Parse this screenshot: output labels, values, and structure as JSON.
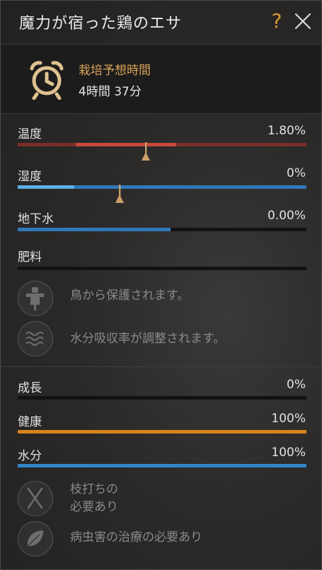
{
  "header": {
    "title": "魔力が宿った鶏のエサ",
    "help_label": "?"
  },
  "timer": {
    "label": "栽培予想時間",
    "value": "4時間 37分"
  },
  "environment": [
    {
      "label": "温度",
      "value": "1.80%",
      "color": "#c9493b"
    },
    {
      "label": "湿度",
      "value": "0%",
      "color": "#3a8cc8"
    },
    {
      "label": "地下水",
      "value": "0.00%",
      "fill_fraction": 0.53,
      "color": "#2f78b8"
    },
    {
      "label": "肥料",
      "value": "",
      "fill_fraction": 0
    }
  ],
  "environment_effects": [
    {
      "icon": "scarecrow-icon",
      "text": "鳥から保護されます。"
    },
    {
      "icon": "water-waves-icon",
      "text": "水分吸収率が調整されます。"
    }
  ],
  "condition": [
    {
      "label": "成長",
      "value": "0%",
      "fill_fraction": 0,
      "color": "#888888"
    },
    {
      "label": "健康",
      "value": "100%",
      "fill_fraction": 1.0,
      "color": "#d9831c"
    },
    {
      "label": "水分",
      "value": "100%",
      "fill_fraction": 1.0,
      "color": "#2f86c8"
    }
  ],
  "condition_effects": [
    {
      "icon": "pruning-shears-icon",
      "line1": "枝打ちの",
      "line2": "必要あり"
    },
    {
      "icon": "leaf-icon",
      "text": "病虫害の治療の必要あり"
    }
  ]
}
